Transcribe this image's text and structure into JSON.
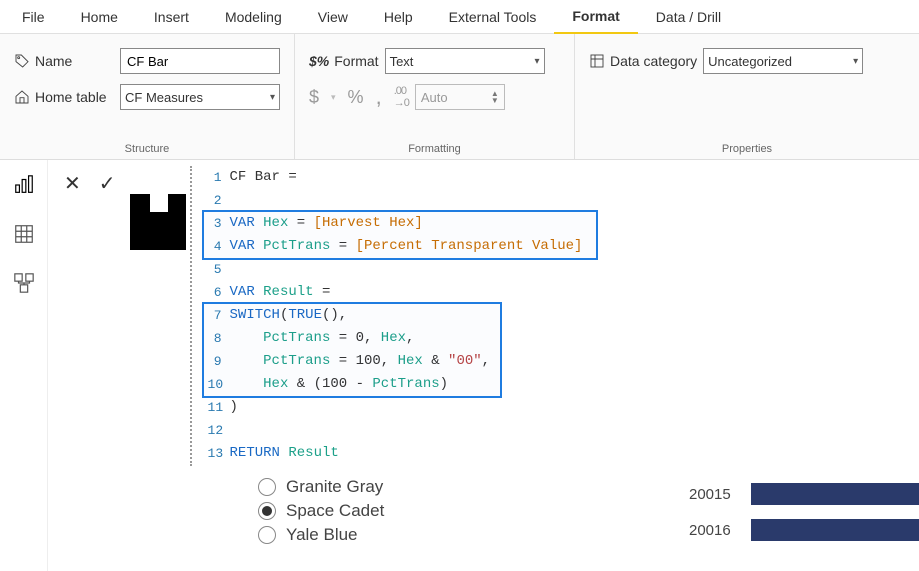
{
  "menubar": {
    "items": [
      "File",
      "Home",
      "Insert",
      "Modeling",
      "View",
      "Help",
      "External Tools",
      "Format",
      "Data / Drill"
    ],
    "active": "Format"
  },
  "ribbon": {
    "structure": {
      "name_label": "Name",
      "name_value": "CF Bar",
      "home_table_label": "Home table",
      "home_table_value": "CF Measures",
      "group_title": "Structure"
    },
    "formatting": {
      "format_label": "Format",
      "format_value": "Text",
      "currency_symbol": "$",
      "percent_symbol": "%",
      "comma_symbol": ",",
      "decimal_icon": ".00→.0",
      "spinner_value": "Auto",
      "group_title": "Formatting",
      "prefix_icon": "$%"
    },
    "properties": {
      "data_category_label": "Data category",
      "data_category_value": "Uncategorized",
      "group_title": "Properties"
    }
  },
  "editor": {
    "lines": [
      {
        "n": 1,
        "tokens": [
          [
            "txt",
            "CF Bar ="
          ]
        ]
      },
      {
        "n": 2,
        "tokens": []
      },
      {
        "n": 3,
        "tokens": [
          [
            "kw",
            "VAR"
          ],
          [
            "txt",
            " "
          ],
          [
            "var",
            "Hex"
          ],
          [
            "txt",
            " = "
          ],
          [
            "measure",
            "[Harvest Hex]"
          ]
        ]
      },
      {
        "n": 4,
        "tokens": [
          [
            "kw",
            "VAR"
          ],
          [
            "txt",
            " "
          ],
          [
            "var",
            "PctTrans"
          ],
          [
            "txt",
            " = "
          ],
          [
            "measure",
            "[Percent Transparent Value]"
          ]
        ]
      },
      {
        "n": 5,
        "tokens": []
      },
      {
        "n": 6,
        "tokens": [
          [
            "kw",
            "VAR"
          ],
          [
            "txt",
            " "
          ],
          [
            "var",
            "Result"
          ],
          [
            "txt",
            " ="
          ]
        ]
      },
      {
        "n": 7,
        "tokens": [
          [
            "fn",
            "SWITCH"
          ],
          [
            "txt",
            "("
          ],
          [
            "fn",
            "TRUE"
          ],
          [
            "txt",
            "(),"
          ]
        ]
      },
      {
        "n": 8,
        "tokens": [
          [
            "txt",
            "    "
          ],
          [
            "var",
            "PctTrans"
          ],
          [
            "txt",
            " = "
          ],
          [
            "num",
            "0"
          ],
          [
            "txt",
            ", "
          ],
          [
            "var",
            "Hex"
          ],
          [
            "txt",
            ","
          ]
        ]
      },
      {
        "n": 9,
        "tokens": [
          [
            "txt",
            "    "
          ],
          [
            "var",
            "PctTrans"
          ],
          [
            "txt",
            " = "
          ],
          [
            "num",
            "100"
          ],
          [
            "txt",
            ", "
          ],
          [
            "var",
            "Hex"
          ],
          [
            "txt",
            " & "
          ],
          [
            "str",
            "\"00\""
          ],
          [
            "txt",
            ","
          ]
        ]
      },
      {
        "n": 10,
        "tokens": [
          [
            "txt",
            "    "
          ],
          [
            "var",
            "Hex"
          ],
          [
            "txt",
            " & ("
          ],
          [
            "num",
            "100"
          ],
          [
            "txt",
            " - "
          ],
          [
            "var",
            "PctTrans"
          ],
          [
            "txt",
            ")"
          ]
        ]
      },
      {
        "n": 11,
        "tokens": [
          [
            "txt",
            ")"
          ]
        ]
      },
      {
        "n": 12,
        "tokens": []
      },
      {
        "n": 13,
        "tokens": [
          [
            "kw",
            "RETURN"
          ],
          [
            "txt",
            " "
          ],
          [
            "var",
            "Result"
          ]
        ]
      }
    ]
  },
  "radio_options": {
    "items": [
      {
        "label": "Granite Gray",
        "selected": false
      },
      {
        "label": "Space Cadet",
        "selected": true
      },
      {
        "label": "Yale Blue",
        "selected": false
      }
    ]
  },
  "bars": {
    "rows": [
      {
        "label": "20015"
      },
      {
        "label": "20016"
      }
    ]
  },
  "side_rail": {
    "items": [
      "report-view-icon",
      "data-view-icon",
      "model-view-icon"
    ]
  },
  "formula_controls": {
    "cancel": "✕",
    "commit": "✓"
  }
}
